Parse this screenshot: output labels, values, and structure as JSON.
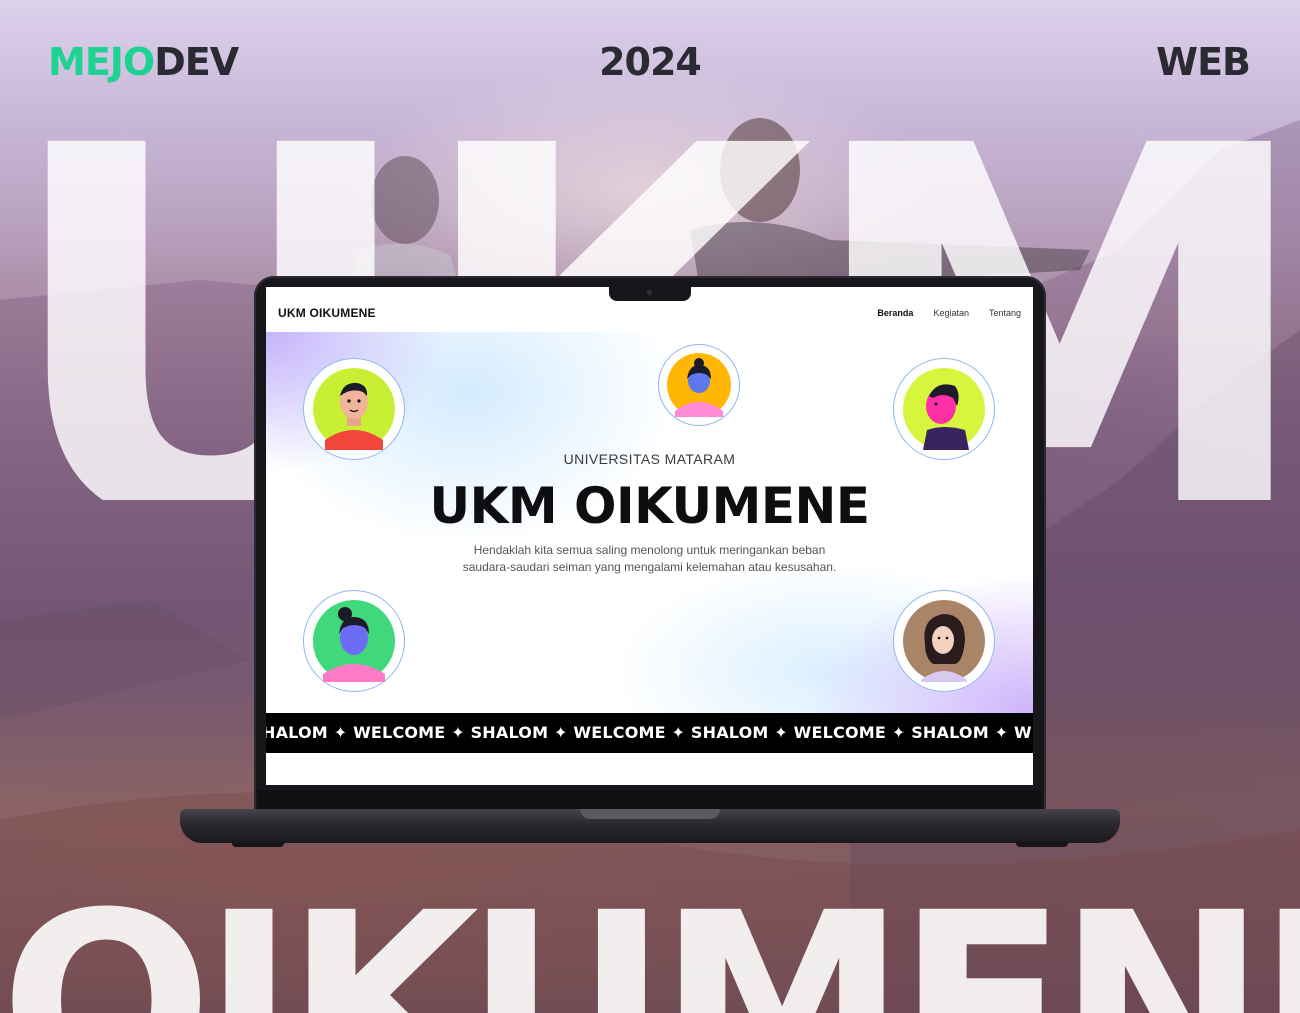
{
  "header": {
    "brand_part1": "MEJO",
    "brand_part2": "DEV",
    "year": "2024",
    "category": "WEB"
  },
  "background": {
    "big_text_top": "UKM",
    "big_text_bottom": "OIKUMENE"
  },
  "website": {
    "nav": {
      "logo": "UKM OIKUMENE",
      "links": [
        "Beranda",
        "Kegiatan",
        "Tentang"
      ],
      "active": "Beranda"
    },
    "hero": {
      "subtitle": "UNIVERSITAS MATARAM",
      "title": "UKM OIKUMENE",
      "description_line1": "Hendaklah kita semua saling menolong untuk meringankan beban",
      "description_line2": "saudara-saudari seiman yang mengalami kelemahan atau kesusahan."
    },
    "marquee": {
      "text": "HALOM ✦ WELCOME ✦ SHALOM ✦ WELCOME ✦ SHALOM ✦ WELCOME ✦ SHALOM ✦ WELCOME"
    }
  },
  "colors": {
    "brand_green": "#1ed391",
    "dark_text": "#2a2a33",
    "avatar_ring": "#8fb8ec"
  }
}
